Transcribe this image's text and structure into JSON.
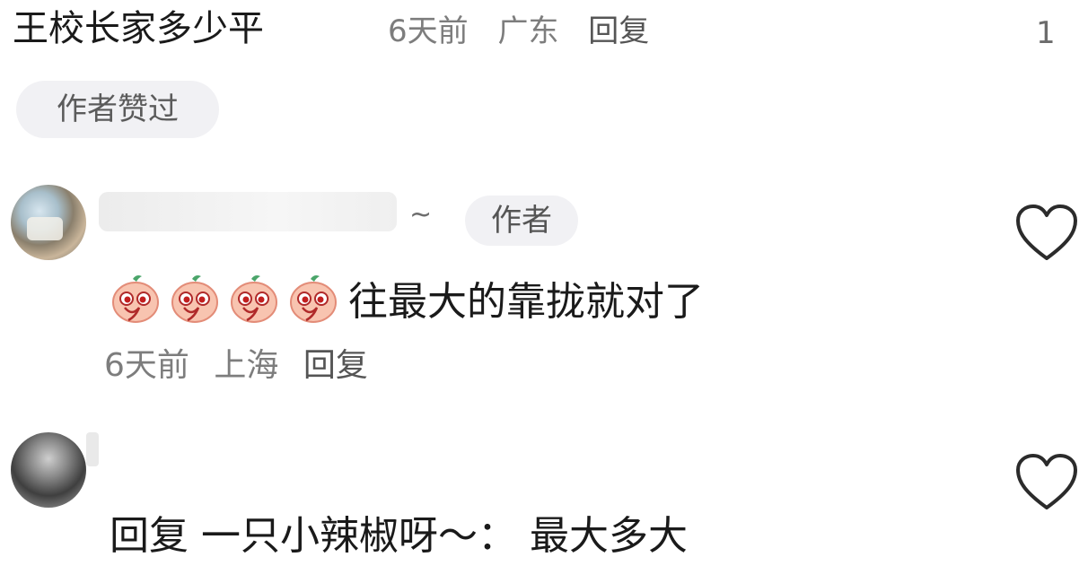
{
  "top_comment": {
    "text": "王校长家多少平",
    "time": "6天前",
    "location": "广东",
    "reply_label": "回复",
    "like_count": "1",
    "author_liked_tag": "作者赞过"
  },
  "comments": [
    {
      "username_hidden": true,
      "tilde": "~",
      "author_badge": "作者",
      "emoji_icon": "peach-face-emoji",
      "emoji_count": 4,
      "text": "往最大的靠拢就对了",
      "time": "6天前",
      "location": "上海",
      "reply_label": "回复",
      "like_icon": "heart-outline-icon"
    },
    {
      "username_hidden": true,
      "text": "回复  一只小辣椒呀～：  最大多大",
      "like_icon": "heart-outline-icon"
    }
  ]
}
